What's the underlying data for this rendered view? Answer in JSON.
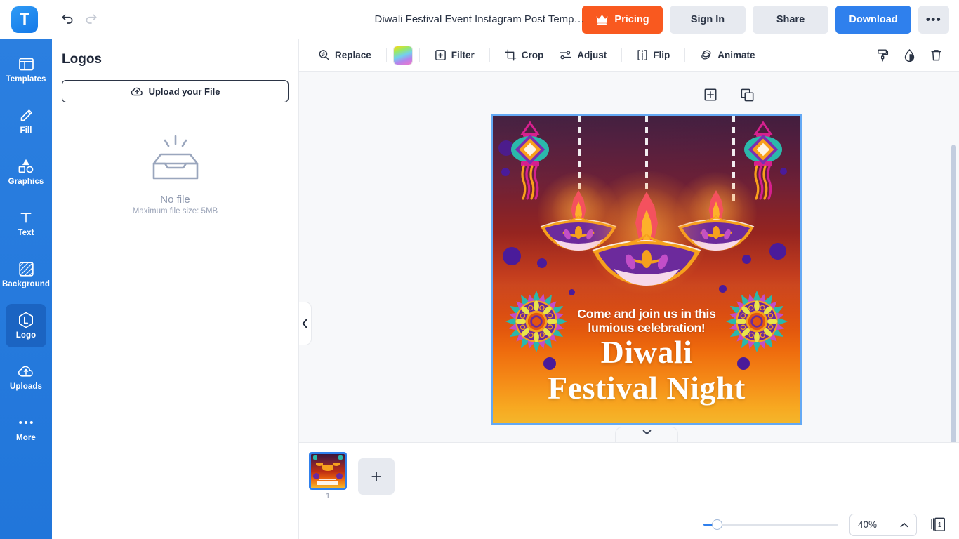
{
  "app": {
    "brand_initial": "T",
    "accent_blue": "#2f80ed",
    "accent_orange": "#f9591f",
    "rail_blue": "#2b7fe0"
  },
  "topbar": {
    "undo_icon": "undo-icon",
    "redo_icon": "redo-icon",
    "document_title": "Diwali Festival Event Instagram Post Temp…",
    "pricing_label": "Pricing",
    "pricing_icon": "crown-icon",
    "signin_label": "Sign In",
    "share_label": "Share",
    "download_label": "Download",
    "more_label": "•••"
  },
  "rail": {
    "items": [
      {
        "label": "Templates",
        "icon": "templates-icon",
        "active": false
      },
      {
        "label": "Fill",
        "icon": "pencil-icon",
        "active": false
      },
      {
        "label": "Graphics",
        "icon": "shapes-icon",
        "active": false
      },
      {
        "label": "Text",
        "icon": "text-t-icon",
        "active": false
      },
      {
        "label": "Background",
        "icon": "background-icon",
        "active": false
      },
      {
        "label": "Logo",
        "icon": "logo-hex-icon",
        "active": true
      },
      {
        "label": "Uploads",
        "icon": "upload-cloud-icon",
        "active": false
      },
      {
        "label": "More",
        "icon": "ellipsis-icon",
        "active": false
      }
    ]
  },
  "panel": {
    "title": "Logos",
    "upload_label": "Upload your File",
    "upload_icon": "upload-cloud-icon",
    "empty_icon": "empty-tray-icon",
    "empty_title": "No file",
    "empty_hint": "Maximum file size: 5MB"
  },
  "toolbar": {
    "items": [
      {
        "label": "Replace",
        "icon": "replace-icon"
      },
      {
        "label": "Filter",
        "icon": "filter-icon"
      },
      {
        "label": "Crop",
        "icon": "crop-icon"
      },
      {
        "label": "Adjust",
        "icon": "adjust-sliders-icon"
      },
      {
        "label": "Flip",
        "icon": "flip-icon"
      },
      {
        "label": "Animate",
        "icon": "animate-icon"
      }
    ],
    "color_swatch": "gradient-color-swatch",
    "right_icons": [
      {
        "icon": "paint-roller-icon"
      },
      {
        "icon": "opacity-drop-icon"
      },
      {
        "icon": "trash-icon"
      }
    ]
  },
  "canvas": {
    "object_tools": [
      {
        "icon": "add-frame-icon"
      },
      {
        "icon": "duplicate-icon"
      }
    ],
    "collapse_icon": "chevron-left-icon",
    "expand_icon": "chevron-down-icon",
    "artwork": {
      "subtitle_line1": "Come and join us in this",
      "subtitle_line2": "lumious celebration!",
      "title_line1": "Diwali",
      "title_line2": "Festival Night"
    }
  },
  "pages": {
    "thumbnails": [
      {
        "number": "1",
        "selected": true
      }
    ],
    "add_label": "+"
  },
  "bottombar": {
    "zoom_value": "40%",
    "zoom_caret": "chevron-up-icon",
    "page_count": "1",
    "pages_icon": "pages-stack-icon"
  }
}
